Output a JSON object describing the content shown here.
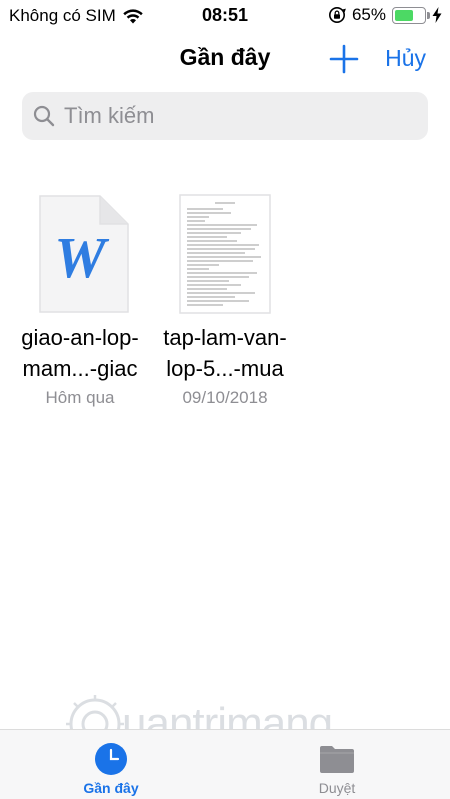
{
  "status_bar": {
    "carrier": "Không có SIM",
    "time": "08:51",
    "battery_percent": "65%",
    "battery_level": 0.65,
    "colors": {
      "battery": "#4cd964"
    }
  },
  "nav": {
    "title": "Gần đây",
    "cancel_label": "Hủy",
    "add_icon": "plus-icon"
  },
  "search": {
    "placeholder": "Tìm kiếm",
    "icon": "magnifier-icon"
  },
  "files": [
    {
      "name_line1": "giao-an-lop-",
      "name_line2": "mam...-giac",
      "date": "Hôm qua",
      "thumb": "word-document-icon"
    },
    {
      "name_line1": "tap-lam-van-",
      "name_line2": "lop-5...-mua",
      "date": "09/10/2018",
      "thumb": "text-page-preview"
    }
  ],
  "watermark": {
    "text": "uantrimang"
  },
  "tabs": [
    {
      "label": "Gần đây",
      "icon": "clock-icon",
      "active": true
    },
    {
      "label": "Duyệt",
      "icon": "folder-icon",
      "active": false
    }
  ],
  "colors": {
    "accent": "#1a73e8",
    "secondary_text": "#8e8e93",
    "search_bg": "#eeeeef",
    "word_blue": "#2f7de1"
  }
}
